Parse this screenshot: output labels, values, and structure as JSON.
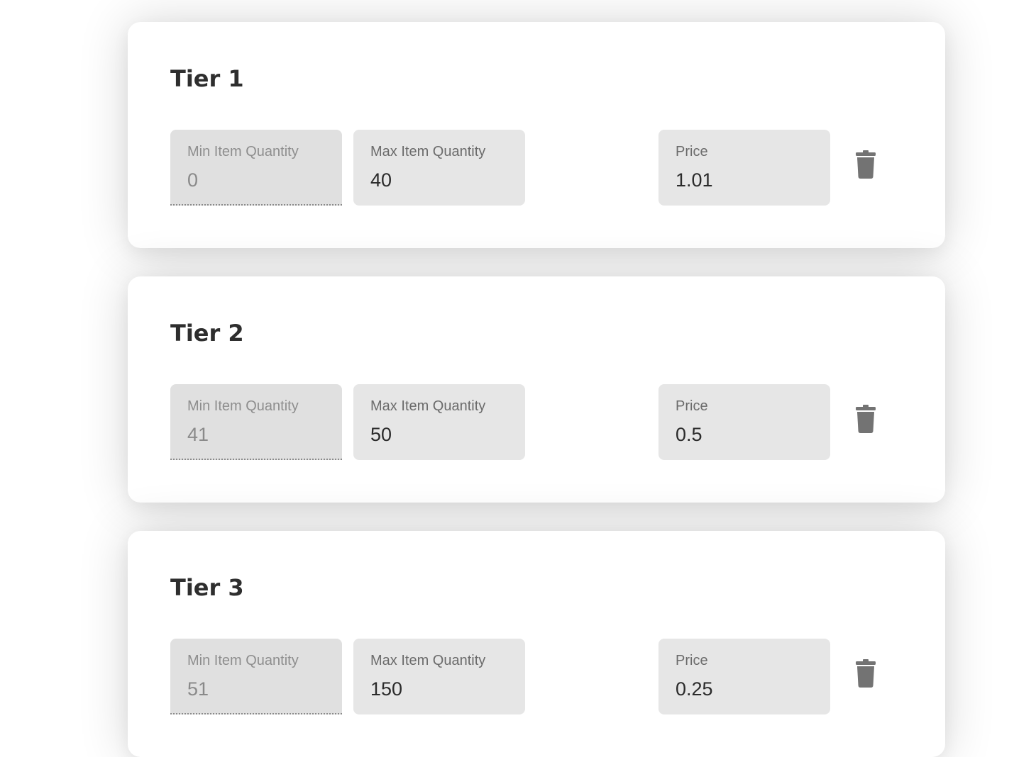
{
  "colors": {
    "card_background": "#ffffff",
    "field_background": "#e6e6e6",
    "disabled_field_background": "#e0e0e0",
    "title_text": "#2e2e2e",
    "icon": "#737373"
  },
  "tiers": [
    {
      "title": "Tier 1",
      "min": {
        "label": "Min Item Quantity",
        "value": "0"
      },
      "max": {
        "label": "Max Item Quantity",
        "value": "40"
      },
      "price": {
        "label": "Price",
        "value": "1.01"
      },
      "delete_icon": "trash-icon"
    },
    {
      "title": "Tier 2",
      "min": {
        "label": "Min Item Quantity",
        "value": "41"
      },
      "max": {
        "label": "Max Item Quantity",
        "value": "50"
      },
      "price": {
        "label": "Price",
        "value": "0.5"
      },
      "delete_icon": "trash-icon"
    },
    {
      "title": "Tier 3",
      "min": {
        "label": "Min Item Quantity",
        "value": "51"
      },
      "max": {
        "label": "Max Item Quantity",
        "value": "150"
      },
      "price": {
        "label": "Price",
        "value": "0.25"
      },
      "delete_icon": "trash-icon"
    }
  ]
}
